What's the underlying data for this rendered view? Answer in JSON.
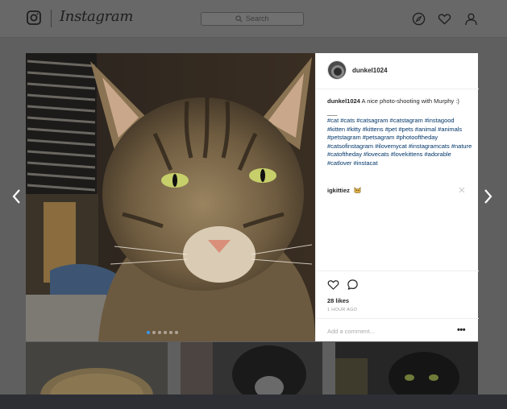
{
  "app": {
    "wordmark": "Instagram"
  },
  "search": {
    "placeholder": "Search"
  },
  "post": {
    "username": "dunkel1024",
    "caption_text": "A nice photo-shooting with Murphy :)",
    "caption_dash": "___",
    "hashtags": "#cat #cats #catsagram #catstagram #instagood #kitten #kitty #kittens #pet #pets #animal #animals #petstagram #petsagram #photooftheday #catsofinstagram #ilovemycat #instagramcats #nature #catoftheday #lovecats #lovekittens #adorable #catlover #instacat",
    "likes": "28 likes",
    "time_ago": "1 HOUR AGO",
    "carousel_count": 6,
    "carousel_index": 1
  },
  "comments": [
    {
      "username": "igkittiez"
    }
  ],
  "add_comment": {
    "placeholder": "Add a comment..."
  },
  "colors": {
    "link": "#003569",
    "active_dot": "#3897f0",
    "nav_dim": "#686868"
  },
  "icons": [
    "instagram-glyph-icon",
    "search-icon",
    "compass-icon",
    "heart-icon",
    "user-icon",
    "chevron-left-icon",
    "chevron-right-icon",
    "comment-icon",
    "close-icon",
    "more-icon",
    "cat-emoji-icon"
  ]
}
